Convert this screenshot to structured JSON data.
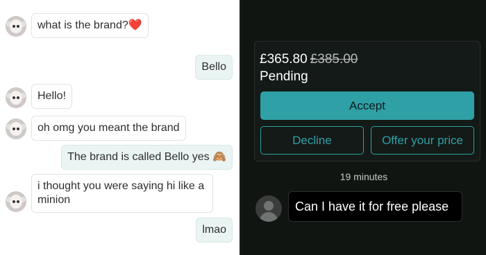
{
  "left_chat": {
    "messages": [
      {
        "side": "in",
        "text": "what is the brand?",
        "emoji": "❤️"
      },
      {
        "side": "out",
        "text": "Bello"
      },
      {
        "side": "in",
        "text": "Hello!"
      },
      {
        "side": "in",
        "text": "oh omg you meant the brand"
      },
      {
        "side": "out",
        "text": "The brand is called Bello yes",
        "emoji": "🙈"
      },
      {
        "side": "in",
        "text_line1": "i thought you were saying hi like a",
        "text_line2": "minion"
      },
      {
        "side": "out",
        "text": "lmao"
      }
    ],
    "colors": {
      "incoming_bg": "#ffffff",
      "outgoing_bg": "#e9f4f3"
    }
  },
  "offer_card": {
    "price": "£365.80",
    "original_price": "£385.00",
    "status": "Pending",
    "accept_label": "Accept",
    "decline_label": "Decline",
    "offer_label": "Offer your price"
  },
  "dark_chat": {
    "timestamp": "19 minutes",
    "message": "Can I have it for free please"
  },
  "colors": {
    "accent": "#2fa0a6",
    "dark_bg": "#111512"
  }
}
